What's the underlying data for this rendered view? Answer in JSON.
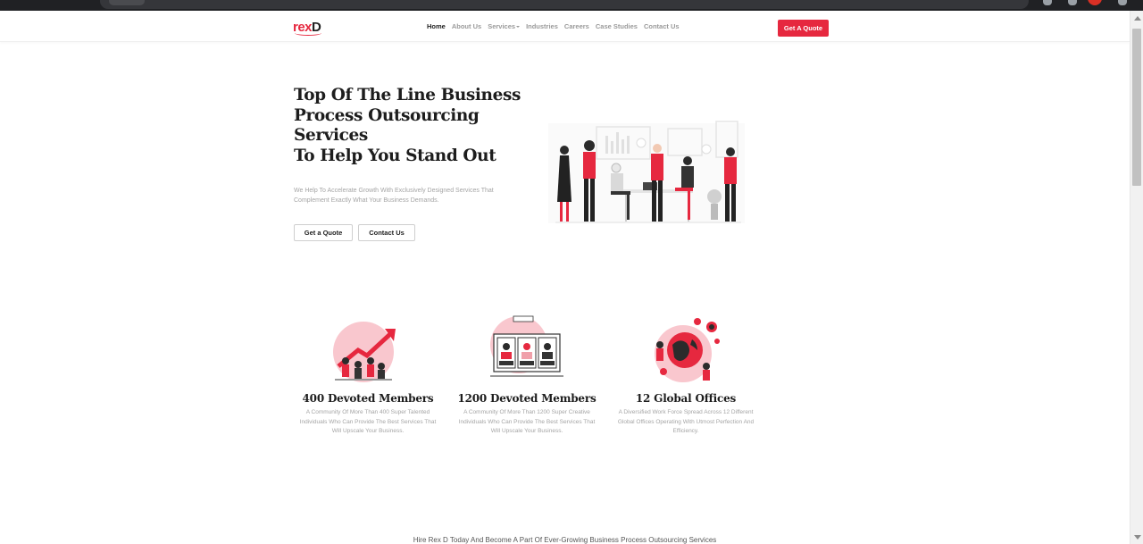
{
  "brand": {
    "logo_main": "rex",
    "logo_d": "D",
    "accent": "#e6283f"
  },
  "nav": {
    "items": [
      {
        "label": "Home",
        "active": true
      },
      {
        "label": "About Us"
      },
      {
        "label": "Services",
        "has_dropdown": true
      },
      {
        "label": "Industries"
      },
      {
        "label": "Careers"
      },
      {
        "label": "Case Studies"
      },
      {
        "label": "Contact Us"
      }
    ],
    "cta": "Get A Quote"
  },
  "hero": {
    "title_lines": [
      "Top Of The Line Business",
      "Process Outsourcing",
      "Services",
      "To Help You Stand Out"
    ],
    "subtitle": "We Help To Accelerate Growth With Exclusively Designed Services That Complement Exactly What Your Business Demands.",
    "buttons": {
      "quote": "Get a Quote",
      "contact": "Contact Us"
    }
  },
  "features": [
    {
      "title": "400 Devoted Members",
      "text": "A Community Of More Than 400 Super Talented Individuals Who Can Provide The Best Services That Will Upscale Your Business.",
      "icon": "team-growth-illustration"
    },
    {
      "title": "1200 Devoted Members",
      "text": "A Community Of More Than 1200 Super Creative Individuals Who Can Provide The Best Services That Will Upscale Your Business.",
      "icon": "team-profiles-illustration"
    },
    {
      "title": "12 Global Offices",
      "text": "A Diversified Work Force Spread Across 12 Different Global Offices Operating With Utmost Perfection And Efficiency.",
      "icon": "globe-network-illustration"
    }
  ],
  "tagline": "Hire Rex D Today And Become A Part Of Ever-Growing Business Process Outsourcing Services"
}
